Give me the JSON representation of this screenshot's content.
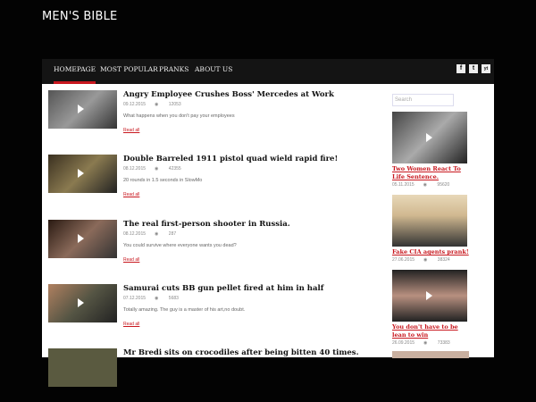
{
  "site": {
    "title": "MEN'S BIBLE"
  },
  "nav": {
    "items": [
      "HOMEPAGE",
      "MOST POPULAR",
      "PRANKS",
      "ABOUT US"
    ]
  },
  "social": [
    "f",
    "t",
    "yt"
  ],
  "posts": [
    {
      "title": "Angry Employee Crushes Boss' Mercedes at Work",
      "date": "09.12.2015",
      "views": "12053",
      "excerpt": "What happens when you don't pay your employees",
      "more": "Read all"
    },
    {
      "title": "Double Barreled 1911 pistol quad wield rapid fire!",
      "date": "08.12.2015",
      "views": "42355",
      "excerpt": "20 rounds in 1.5 seconds in SlowMo",
      "more": "Read all"
    },
    {
      "title": "The real first-person shooter in Russia.",
      "date": "08.12.2015",
      "views": "287",
      "excerpt": "You could survive where everyone wants you dead?",
      "more": "Read all"
    },
    {
      "title": "Samurai cuts BB gun pellet fired at him in half",
      "date": "07.12.2015",
      "views": "5683",
      "excerpt": "Totally amazing. The guy is a master of his art,no doubt.",
      "more": "Read all"
    },
    {
      "title": "Mr Bredi sits on crocodiles after being bitten 40 times."
    }
  ],
  "sidebar": {
    "search_placeholder": "Search",
    "items": [
      {
        "title": "Two Women React To Life Sentence.",
        "date": "05.11.2015",
        "views": "95620"
      },
      {
        "title": "Fake CIA agents prank!",
        "date": "27.06.2015",
        "views": "38324"
      },
      {
        "title": "You don't have to be lean to win",
        "date": "26.09.2015",
        "views": "73383"
      }
    ]
  }
}
